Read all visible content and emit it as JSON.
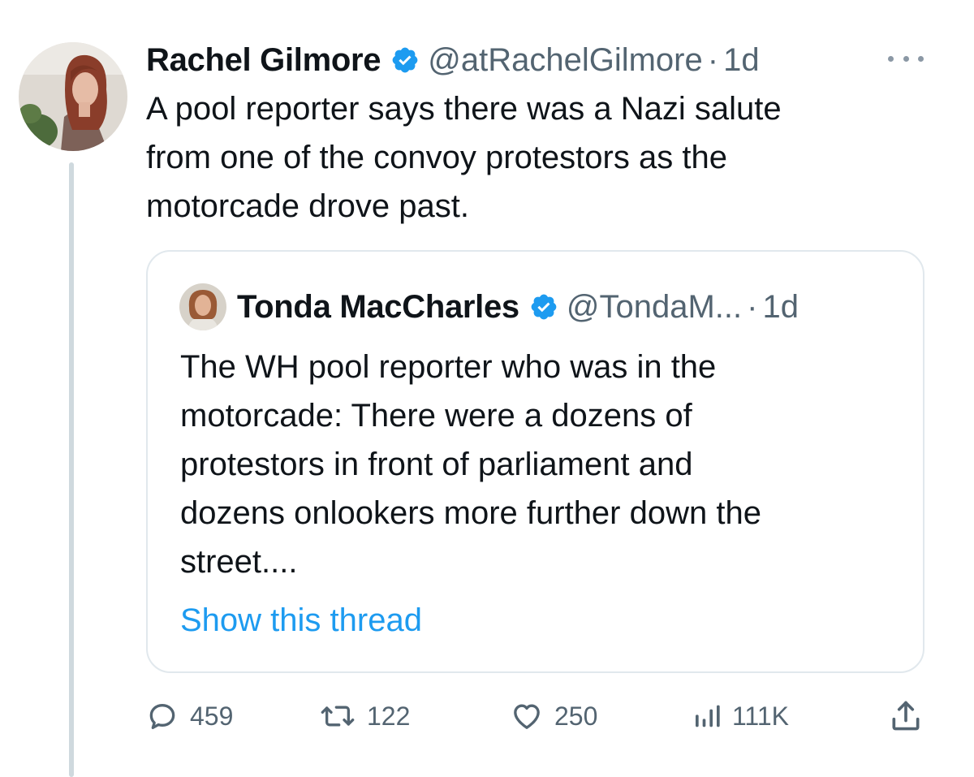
{
  "tweet": {
    "author_name": "Rachel Gilmore",
    "handle": "@atRachelGilmore",
    "separator": "·",
    "time": "1d",
    "text_lines": [
      "A pool reporter says there was a Nazi salute",
      "from one of the convoy protestors as the",
      "motorcade drove past."
    ]
  },
  "quoted_tweet": {
    "author_name": "Tonda MacCharles",
    "handle": "@TondaM...",
    "separator": "·",
    "time": "1d",
    "text_lines": [
      "The WH pool reporter who was in the",
      "motorcade: There were a dozens of",
      "protestors in front of parliament and",
      "dozens onlookers more further down the",
      "street...."
    ],
    "show_thread": "Show this thread"
  },
  "actions": {
    "replies": "459",
    "reposts": "122",
    "likes": "250",
    "views": "111K"
  },
  "icons": {
    "verified": "verified-badge-icon",
    "more": "more-options-icon",
    "reply": "reply-icon",
    "repost": "repost-icon",
    "like": "heart-icon",
    "views": "views-icon",
    "share": "share-icon"
  },
  "colors": {
    "text": "#0f1419",
    "secondary": "#536471",
    "link": "#1d9bf0",
    "verified": "#1d9bf0",
    "border": "#e1e8ed",
    "thread_line": "#cfd9de"
  }
}
